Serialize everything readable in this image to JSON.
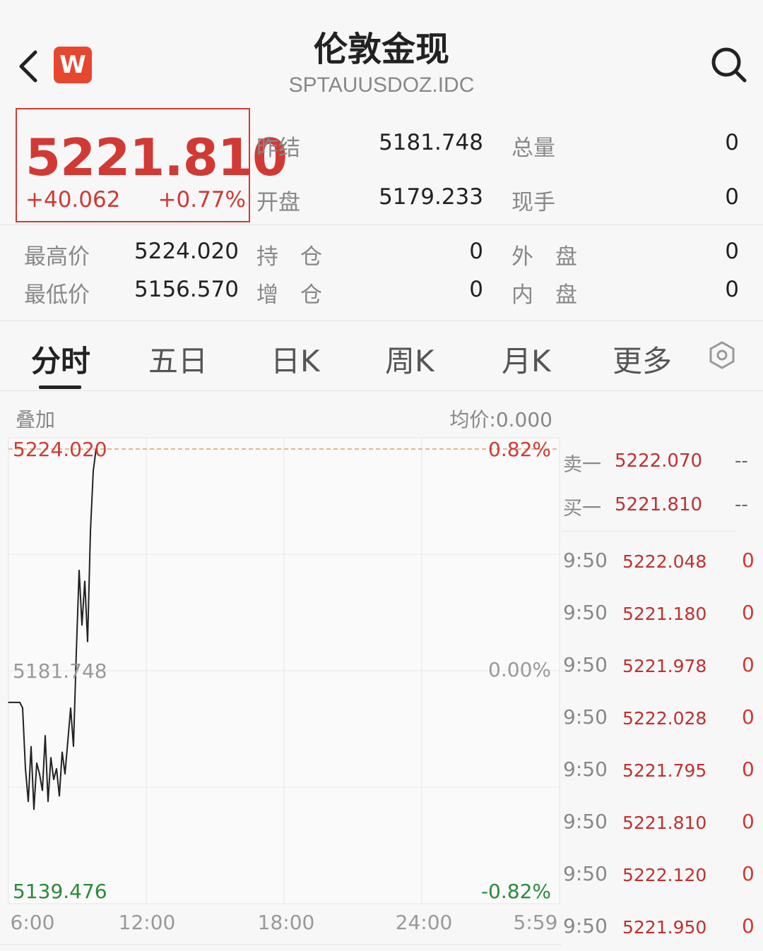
{
  "header": {
    "title": "伦敦金现",
    "code": "SPTAUUSDOZ.IDC",
    "app_badge": "W",
    "icons": {
      "back": "chevron-left-icon",
      "search": "search-icon"
    }
  },
  "quote": {
    "price": "5221.810",
    "change": "+40.062",
    "change_pct": "+0.77%",
    "stats": {
      "prev_close_label": "昨结",
      "prev_close": "5181.748",
      "open_label": "开盘",
      "open": "5179.233",
      "volume_label": "总量",
      "volume": "0",
      "current_hand_label": "现手",
      "current_hand": "0",
      "high_label": "最高价",
      "high": "5224.020",
      "low_label": "最低价",
      "low": "5156.570",
      "position_label": "持　仓",
      "position": "0",
      "position_change_label": "增　仓",
      "position_change": "0",
      "outer_label": "外　盘",
      "outer": "0",
      "inner_label": "内　盘",
      "inner": "0"
    }
  },
  "tabs": [
    {
      "label": "分时",
      "active": true
    },
    {
      "label": "五日"
    },
    {
      "label": "日K"
    },
    {
      "label": "周K"
    },
    {
      "label": "月K"
    },
    {
      "label": "更多"
    }
  ],
  "chart_header": {
    "overlay": "叠加",
    "avg_price": "均价:0.000"
  },
  "chart_data": {
    "type": "line",
    "y_labels_left": [
      "5224.020",
      "5181.748",
      "5139.476"
    ],
    "y_labels_right": [
      "0.82%",
      "0.00%",
      "-0.82%"
    ],
    "x_labels": [
      "6:00",
      "12:00",
      "18:00",
      "24:00",
      "5:59"
    ],
    "ylim": [
      5139.476,
      5224.02
    ],
    "reference_price": 5181.748,
    "series": [
      {
        "values": [
          5176,
          5176,
          5176,
          5176,
          5176,
          5175,
          5164,
          5158,
          5168,
          5156.57,
          5165,
          5163,
          5160,
          5170,
          5158,
          5166,
          5162,
          5164,
          5159,
          5167,
          5163,
          5169,
          5175,
          5168,
          5185,
          5200,
          5190,
          5198,
          5187,
          5207,
          5218,
          5224.02
        ]
      }
    ]
  },
  "order_book": {
    "sell1_label": "卖一",
    "sell1_price": "5222.070",
    "sell1_vol": "--",
    "buy1_label": "买一",
    "buy1_price": "5221.810",
    "buy1_vol": "--"
  },
  "trades": [
    {
      "time": "9:50",
      "price": "5222.048",
      "vol": "0"
    },
    {
      "time": "9:50",
      "price": "5221.180",
      "vol": "0"
    },
    {
      "time": "9:50",
      "price": "5221.978",
      "vol": "0"
    },
    {
      "time": "9:50",
      "price": "5222.028",
      "vol": "0"
    },
    {
      "time": "9:50",
      "price": "5221.795",
      "vol": "0"
    },
    {
      "time": "9:50",
      "price": "5221.810",
      "vol": "0"
    },
    {
      "time": "9:50",
      "price": "5222.120",
      "vol": "0"
    },
    {
      "time": "9:50",
      "price": "5221.950",
      "vol": "0"
    }
  ],
  "colors": {
    "up": "#d13a34",
    "down": "#2a8a3a",
    "badge": "#e8472f"
  }
}
